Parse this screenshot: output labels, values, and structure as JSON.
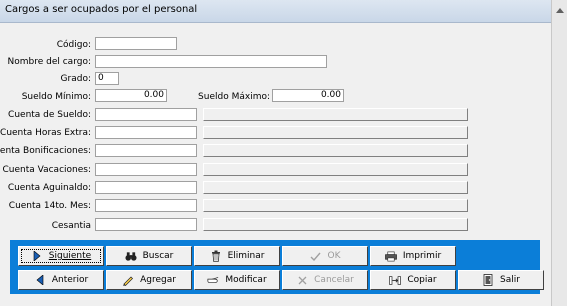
{
  "window": {
    "title": "Cargos a ser ocupados por el personal"
  },
  "fields": {
    "codigo": {
      "label": "Código:",
      "value": ""
    },
    "nombre": {
      "label": "Nombre del cargo:",
      "value": ""
    },
    "grado": {
      "label": "Grado:",
      "value": "0"
    },
    "sueldo_min": {
      "label": "Sueldo Mínimo:",
      "value": "0.00"
    },
    "sueldo_max": {
      "label": "Sueldo Máximo:",
      "value": "0.00"
    },
    "cuenta_sueldo": {
      "label": "Cuenta de Sueldo:",
      "value": ""
    },
    "cuenta_horas": {
      "label": "Cuenta Horas Extra:",
      "value": ""
    },
    "cuenta_bonif": {
      "label": "Cuenta Bonificaciones:",
      "value": ""
    },
    "cuenta_vac": {
      "label": "Cuenta Vacaciones:",
      "value": ""
    },
    "cuenta_aguinaldo": {
      "label": "Cuenta Aguinaldo:",
      "value": ""
    },
    "cuenta_14": {
      "label": "Cuenta 14to. Mes:",
      "value": ""
    },
    "cesantia": {
      "label": "Cesantia",
      "value": ""
    }
  },
  "toolbar": {
    "siguiente": "Siguiente",
    "buscar": "Buscar",
    "eliminar": "Eliminar",
    "ok": "OK",
    "imprimir": "Imprimir",
    "anterior": "Anterior",
    "agregar": "Agregar",
    "modificar": "Modificar",
    "cancelar": "Cancelar",
    "copiar": "Copiar",
    "salir": "Salir"
  },
  "icons": {
    "siguiente": "play-right-icon",
    "anterior": "play-left-icon",
    "buscar": "binoculars-icon",
    "agregar": "pencil-icon",
    "eliminar": "trash-icon",
    "modificar": "hand-icon",
    "ok": "checkmark-icon",
    "cancelar": "x-icon",
    "imprimir": "printer-icon",
    "copiar": "copy-icon",
    "salir": "exit-door-icon"
  },
  "colors": {
    "panel": "#0b7ed8",
    "titlebar": "#c9d7e8"
  }
}
